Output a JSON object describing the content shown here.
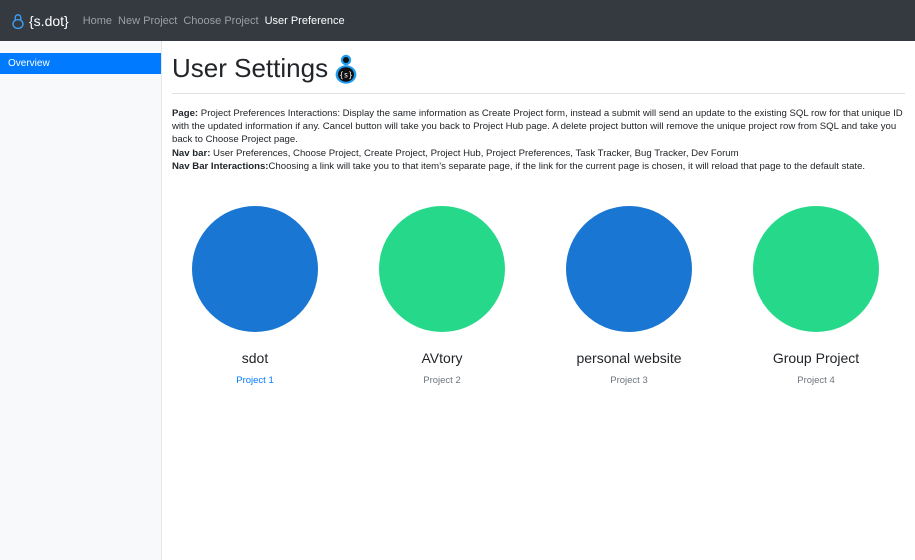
{
  "navbar": {
    "brand_icon": "lock-person-icon",
    "brand_label": "{s.dot}",
    "links": [
      {
        "label": "Home",
        "active": false
      },
      {
        "label": "New Project",
        "active": false
      },
      {
        "label": "Choose Project",
        "active": false
      },
      {
        "label": "User Preference",
        "active": true
      }
    ]
  },
  "sidebar": {
    "items": [
      {
        "label": "Overview",
        "active": true
      }
    ]
  },
  "main": {
    "title": "User Settings",
    "title_icon": "lock-person-icon",
    "description": {
      "page_label": "Page:",
      "page_text": " Project Preferences Interactions: Display the same information as Create Project form, instead a submit will send an update to the existing SQL row for that unique ID with the updated information if any. Cancel button will take you back to Project Hub page. A delete project button will remove the unique project row from SQL and take you back to Choose Project page.",
      "navbar_label": "Nav bar:",
      "navbar_text": " User Preferences, Choose Project, Create Project, Project Hub, Project Preferences, Task Tracker, Bug Tracker, Dev Forum",
      "navinter_label": "Nav Bar Interactions:",
      "navinter_text": "Choosing a link will take you to that item’s separate page, if the link for the current page is chosen, it will reload that page to the default state."
    },
    "projects": [
      {
        "name": "sdot",
        "sub": "Project 1",
        "color": "#1976d2",
        "sub_is_link": true
      },
      {
        "name": "AVtory",
        "sub": "Project 2",
        "color": "#26d98a",
        "sub_is_link": false
      },
      {
        "name": "personal website",
        "sub": "Project 3",
        "color": "#1976d2",
        "sub_is_link": false
      },
      {
        "name": "Group Project",
        "sub": "Project 4",
        "color": "#26d98a",
        "sub_is_link": false
      }
    ]
  },
  "colors": {
    "navbar_bg": "#343a40",
    "accent": "#007bff",
    "blue_circle": "#1976d2",
    "green_circle": "#26d98a"
  }
}
